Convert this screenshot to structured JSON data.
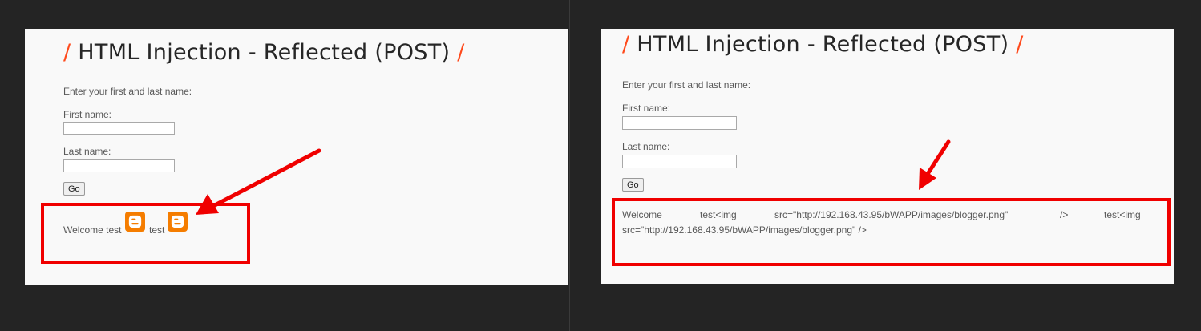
{
  "colors": {
    "background": "#242424",
    "panel": "#f9f9f9",
    "accent_slash": "#ff4a1c",
    "annotation_red": "#f00000",
    "blogger_orange": "#f57d00"
  },
  "left": {
    "title_slash_left": "/",
    "title_text": "HTML Injection - Reflected (POST)",
    "title_slash_right": "/",
    "instruction": "Enter your first and last name:",
    "first_name_label": "First name:",
    "first_name_value": "",
    "last_name_label": "Last name:",
    "last_name_value": "",
    "go_label": "Go",
    "welcome_text": "Welcome test",
    "second_word": "test",
    "icon": "blogger-icon"
  },
  "right": {
    "title_slash_left": "/",
    "title_text": "HTML Injection - Reflected (POST)",
    "title_slash_right": "/",
    "instruction": "Enter your first and last name:",
    "first_name_label": "First name:",
    "first_name_value": "",
    "last_name_label": "Last name:",
    "last_name_value": "",
    "go_label": "Go",
    "echo_line1": [
      "Welcome",
      "test<img",
      "src=\"http://192.168.43.95/bWAPP/images/blogger.png\"",
      "/>",
      "test<img"
    ],
    "echo_line2": "src=\"http://192.168.43.95/bWAPP/images/blogger.png\" />"
  }
}
